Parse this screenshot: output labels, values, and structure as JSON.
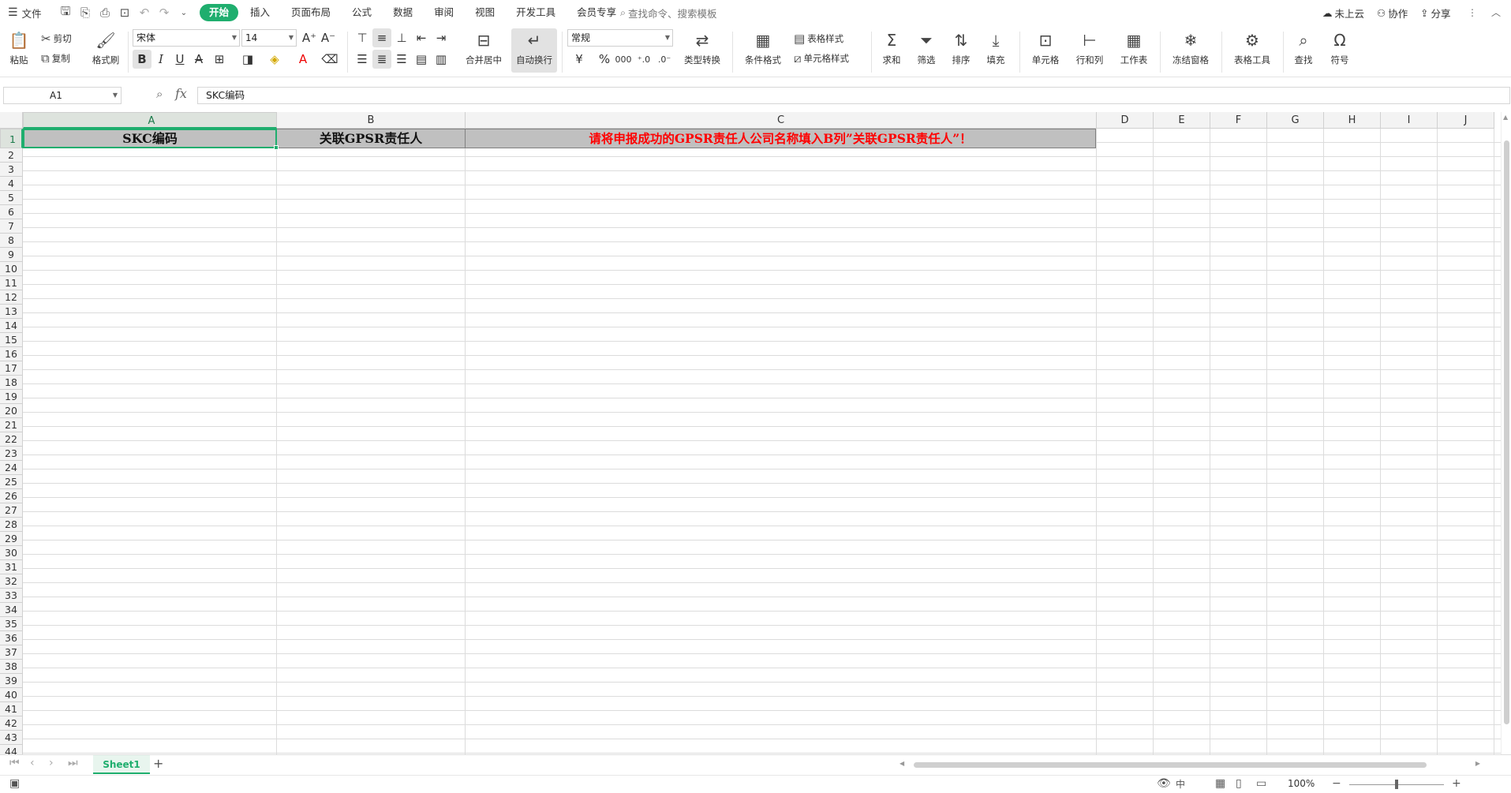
{
  "menubar": {
    "file_label": "文件",
    "tabs": [
      "开始",
      "插入",
      "页面布局",
      "公式",
      "数据",
      "审阅",
      "视图",
      "开发工具",
      "会员专享"
    ],
    "search_placeholder": "查找命令、搜索模板",
    "cloud_label": "未上云",
    "collab_label": "协作",
    "share_label": "分享"
  },
  "ribbon": {
    "paste": "粘贴",
    "cut": "剪切",
    "copy": "复制",
    "format_painter": "格式刷",
    "font_name": "宋体",
    "font_size": "14",
    "merge_center": "合并居中",
    "wrap_text": "自动换行",
    "number_format": "常规",
    "convert": "类型转换",
    "conditional_format": "条件格式",
    "table_style": "表格样式",
    "cell_style": "单元格样式",
    "sum": "求和",
    "filter": "筛选",
    "sort": "排序",
    "fill": "填充",
    "cell": "单元格",
    "rowcol": "行和列",
    "worksheet": "工作表",
    "freeze": "冻结窗格",
    "table_tools": "表格工具",
    "find": "查找",
    "symbol": "符号"
  },
  "formula": {
    "name_box": "A1",
    "fx": "fx",
    "content": "SKC编码"
  },
  "sheet": {
    "columns": [
      "A",
      "B",
      "C",
      "D",
      "E",
      "F",
      "G",
      "H",
      "I",
      "J"
    ],
    "header_cells": [
      "SKC编码",
      "关联GPSR责任人",
      "请将申报成功的GPSR责任人公司名称填入B列”关联GPSR责任人”！"
    ],
    "active_cell": "A1",
    "header_fill": "#c0c0c0",
    "note_color": "#ff0000",
    "accent_color": "#1fae6e"
  },
  "sheetbar": {
    "sheet_name": "Sheet1",
    "add": "+"
  },
  "status": {
    "zoom": "100%",
    "ime": "中"
  }
}
